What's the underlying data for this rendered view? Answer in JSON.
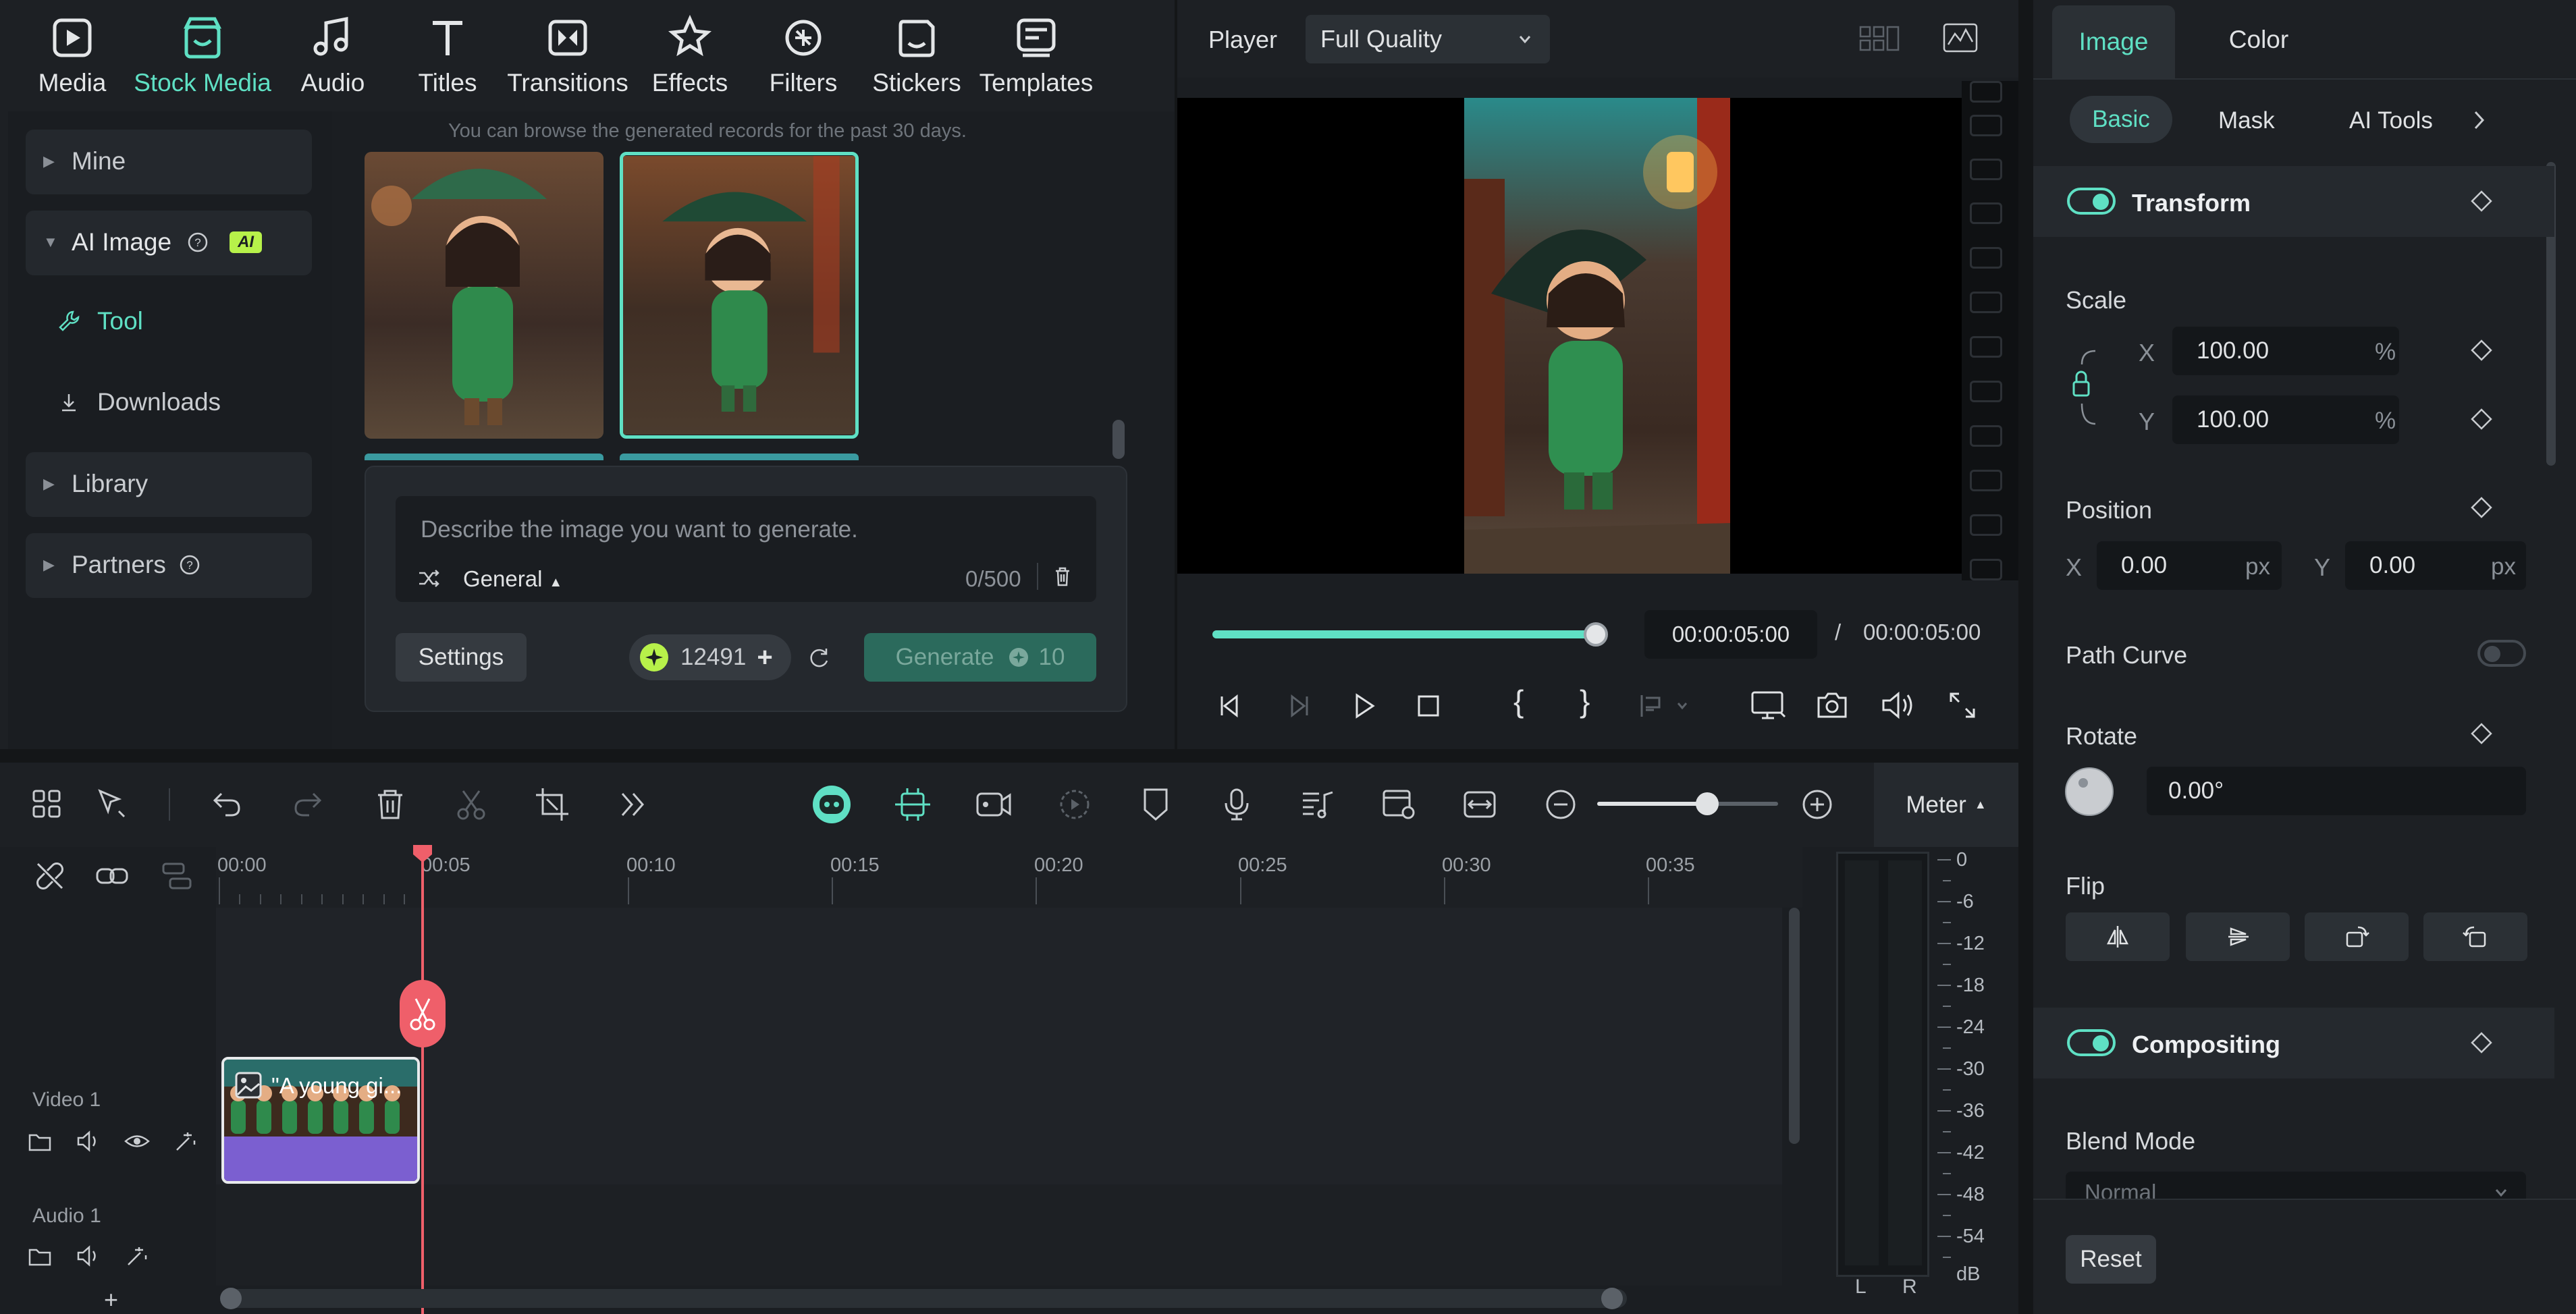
{
  "media_tabs": [
    {
      "label": "Media",
      "icon": "media-icon"
    },
    {
      "label": "Stock Media",
      "icon": "stock-media-icon",
      "active": true
    },
    {
      "label": "Audio",
      "icon": "audio-icon"
    },
    {
      "label": "Titles",
      "icon": "titles-icon"
    },
    {
      "label": "Transitions",
      "icon": "transitions-icon"
    },
    {
      "label": "Effects",
      "icon": "effects-icon"
    },
    {
      "label": "Filters",
      "icon": "filters-icon"
    },
    {
      "label": "Stickers",
      "icon": "stickers-icon"
    },
    {
      "label": "Templates",
      "icon": "templates-icon"
    }
  ],
  "left_nav": {
    "mine": "Mine",
    "ai_image": "AI Image",
    "ai_badge": "AI",
    "tool": "Tool",
    "downloads": "Downloads",
    "library": "Library",
    "partners": "Partners"
  },
  "browser": {
    "notice": "You can browse the generated records for the past 30 days."
  },
  "prompt": {
    "placeholder": "Describe the image you want to generate.",
    "style": "General",
    "counter": "0/500",
    "settings_label": "Settings",
    "credits": "12491",
    "generate_label": "Generate",
    "generate_cost": "10"
  },
  "player": {
    "label": "Player",
    "quality": "Full Quality",
    "current_time": "00:00:05:00",
    "separator": "/",
    "total_time": "00:00:05:00",
    "progress": 1.0
  },
  "props": {
    "tabs": [
      "Image",
      "Color"
    ],
    "subtabs": [
      "Basic",
      "Mask",
      "AI Tools"
    ],
    "transform": "Transform",
    "scale": "Scale",
    "x_label": "X",
    "y_label": "Y",
    "scale_x": "100.00",
    "scale_y": "100.00",
    "percent": "%",
    "position": "Position",
    "pos_x": "0.00",
    "pos_y": "0.00",
    "px": "px",
    "path_curve": "Path Curve",
    "rotate": "Rotate",
    "rotate_value": "0.00°",
    "flip": "Flip",
    "compositing": "Compositing",
    "blend_mode": "Blend Mode",
    "blend_value": "Normal",
    "reset": "Reset"
  },
  "timeline": {
    "meter_label": "Meter",
    "ruler": [
      "00:00",
      "00:05",
      "00:10",
      "00:15",
      "00:20",
      "00:25",
      "00:30",
      "00:35"
    ],
    "video_track": "Video 1",
    "audio_track": "Audio 1",
    "clip_title": "\"A young gi...",
    "add": "+",
    "db_scale": [
      "0",
      "-6",
      "-12",
      "-18",
      "-24",
      "-30",
      "-36",
      "-42",
      "-48",
      "-54",
      "dB"
    ],
    "channels": [
      "L",
      "R"
    ]
  },
  "colors": {
    "accent": "#5fe0c4",
    "playhead": "#ef5f6a",
    "clip_audio": "#7b5fd0"
  }
}
